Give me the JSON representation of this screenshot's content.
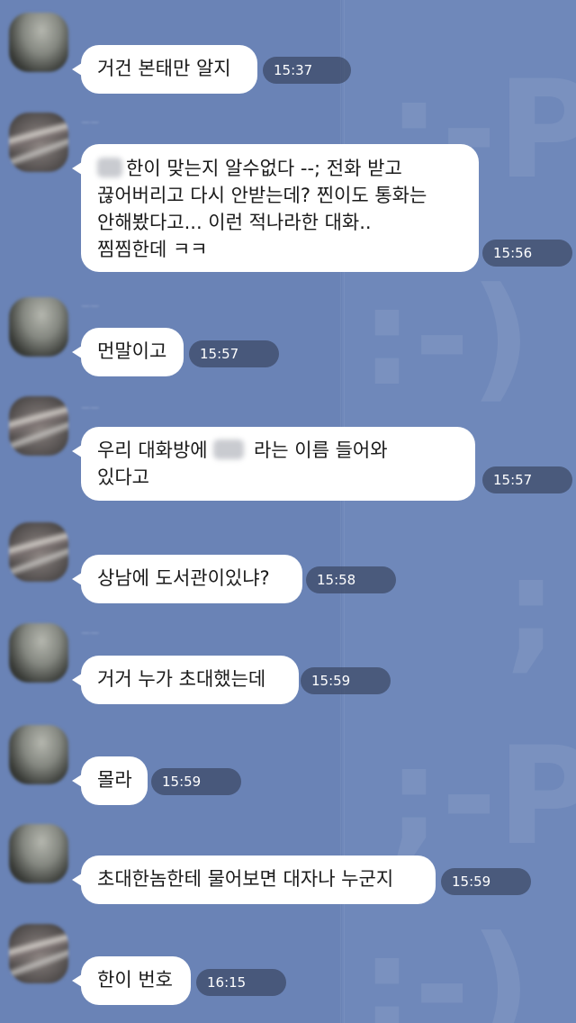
{
  "messages": [
    {
      "avatar": "photo-avatar-dark",
      "lines": [
        "거건 본태만 알지"
      ],
      "time": "15:37"
    },
    {
      "avatar": "photo-avatar-light",
      "lines": [
        "한이 맞는지 알수없다 --; 전화 받고",
        "끊어버리고 다시 안받는데? 찐이도 통화는",
        "안해봤다고... 이런 적나라한 대화..",
        "찜찜한데 ㅋㅋ"
      ],
      "time": "15:56",
      "redacted_prefix": true
    },
    {
      "avatar": "photo-avatar-dark",
      "lines": [
        "먼말이고"
      ],
      "time": "15:57"
    },
    {
      "avatar": "photo-avatar-light",
      "lines_parts": {
        "before": "우리 대화방에",
        "after": "라는 이름 들어와"
      },
      "lines": [
        "있다고"
      ],
      "time": "15:57"
    },
    {
      "avatar": "photo-avatar-light",
      "lines": [
        "상남에 도서관이있냐?"
      ],
      "time": "15:58"
    },
    {
      "avatar": "photo-avatar-dark",
      "lines": [
        "거거 누가 초대했는데"
      ],
      "time": "15:59"
    },
    {
      "avatar": "photo-avatar-dark",
      "lines": [
        "몰라"
      ],
      "time": "15:59"
    },
    {
      "avatar": "photo-avatar-dark",
      "lines": [
        "초대한놈한테 물어보면 대자나 누군지"
      ],
      "time": "15:59"
    },
    {
      "avatar": "photo-avatar-light",
      "lines": [
        "한이 번호"
      ],
      "time": "16:15"
    }
  ],
  "colors": {
    "background": "#6f88ba",
    "bubble": "#ffffff",
    "timestamp_pill": "#3c4864"
  }
}
